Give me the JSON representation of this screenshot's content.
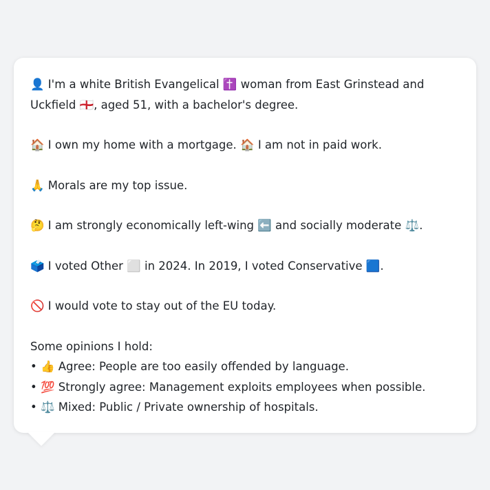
{
  "persona": {
    "intro_line": "👤 I'm a white British Evangelical ✝️ woman from East Grinstead and Uckfield 🏴󠁧󠁢󠁥󠁮󠁧󠁿, aged 51, with a bachelor's degree.",
    "home_work_line": "🏠 I own my home with a mortgage. 🏠 I am not in paid work.",
    "top_issue_line": "🙏 Morals are my top issue.",
    "ideology_line": "🤔 I am strongly economically left-wing ⬅️ and socially moderate ⚖️.",
    "vote_line": "🗳️ I voted Other ⬜ in 2024. In 2019, I voted Conservative 🟦.",
    "eu_line": "🚫 I would vote to stay out of the EU today.",
    "opinions_heading": "Some opinions I hold:",
    "opinions": [
      "• 👍 Agree: People are too easily offended by language.",
      "• 💯 Strongly agree: Management exploits employees when possible.",
      "• ⚖️ Mixed: Public / Private ownership of hospitals."
    ]
  }
}
